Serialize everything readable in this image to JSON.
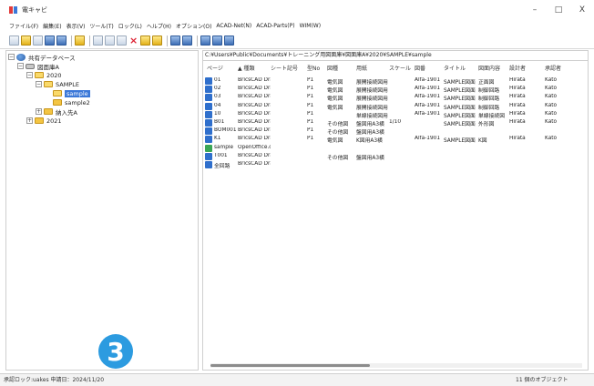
{
  "window": {
    "title": "電キャビ",
    "minimize": "–",
    "maximize": "□",
    "close": "X"
  },
  "menu": [
    "ファイル(F)",
    "編集(E)",
    "表示(V)",
    "ツール(T)",
    "ロック(L)",
    "ヘルプ(H)",
    "オプション(O)",
    "ACAD-Net(N)",
    "ACAD-Parts(P)",
    "WIM(W)"
  ],
  "tree": {
    "root": "共有データベース",
    "db": "図面庫A",
    "year2020": "2020",
    "sample_folder": "SAMPLE",
    "sample": "sample",
    "sample2": "sample2",
    "nonyu": "納入先A",
    "year2021": "2021"
  },
  "path": "C:¥Users¥Public¥Documents¥トレーニング用図面庫¥図面庫A¥2020¥SAMPLE¥sample",
  "list": {
    "headers": [
      "ページ",
      "▲ 種類",
      "シート記号",
      "型No",
      "図種",
      "用紙",
      "スケール",
      "図番",
      "タイトル",
      "図面内容",
      "設計者",
      "承認者"
    ],
    "rows": [
      [
        "01",
        "BricsCAD Drav",
        "",
        "P1",
        "電気図",
        "展開接続図用",
        "",
        "Alfa-1901",
        "SAMPLE図面",
        "正面図",
        "Hirata",
        "Kato"
      ],
      [
        "02",
        "BricsCAD Drav",
        "",
        "P1",
        "電気図",
        "展開接続図用",
        "",
        "Alfa-1901",
        "SAMPLE図面",
        "制御回路",
        "Hirata",
        "Kato"
      ],
      [
        "03",
        "BricsCAD Drav",
        "",
        "P1",
        "電気図",
        "展開接続図用",
        "",
        "Alfa-1901",
        "SAMPLE図面",
        "制御回路",
        "Hirata",
        "Kato"
      ],
      [
        "04",
        "BricsCAD Drav",
        "",
        "P1",
        "電気図",
        "展開接続図用",
        "",
        "Alfa-1901",
        "SAMPLE図面",
        "制御回路",
        "Hirata",
        "Kato"
      ],
      [
        "10",
        "BricsCAD Drav",
        "",
        "P1",
        "",
        "単線接続図用",
        "",
        "Alfa-1901",
        "SAMPLE図面",
        "単線接続図",
        "Hirata",
        "Kato"
      ],
      [
        "B01",
        "BricsCAD Drav",
        "",
        "P1",
        "その他図",
        "盤図用A3横",
        "1/10",
        "",
        "SAMPLE図面",
        "外形図",
        "Hirata",
        "Kato"
      ],
      [
        "BOM001",
        "BricsCAD Drav",
        "",
        "P1",
        "その他図",
        "盤図用A3横",
        "",
        "",
        "",
        "",
        "",
        ""
      ],
      [
        "K1",
        "BricsCAD Drav",
        "",
        "P1",
        "電気図",
        "K図用A3横",
        "",
        "Alfa-1901",
        "SAMPLE図面",
        "K図",
        "Hirata",
        "Kato"
      ],
      [
        "sample",
        "OpenOffice.or",
        "",
        "",
        "",
        "",
        "",
        "",
        "",
        "",
        "",
        ""
      ],
      [
        "T001",
        "BricsCAD Drav",
        "",
        "",
        "その他図",
        "盤図用A3横",
        "",
        "",
        "",
        "",
        "",
        ""
      ],
      [
        "全回路",
        "BricsCAD Drav",
        "",
        "",
        "",
        "",
        "",
        "",
        "",
        "",
        "",
        ""
      ]
    ]
  },
  "badge": "3",
  "status": {
    "left": "承認ロック:uakes 申請日：2024/11/20",
    "right": "11 個のオブジェクト"
  },
  "colors": {
    "selection": "#3b78d8",
    "badge": "#2c9be0",
    "cad_icon": "#2f6fcc",
    "office_icon": "#3aa655"
  }
}
